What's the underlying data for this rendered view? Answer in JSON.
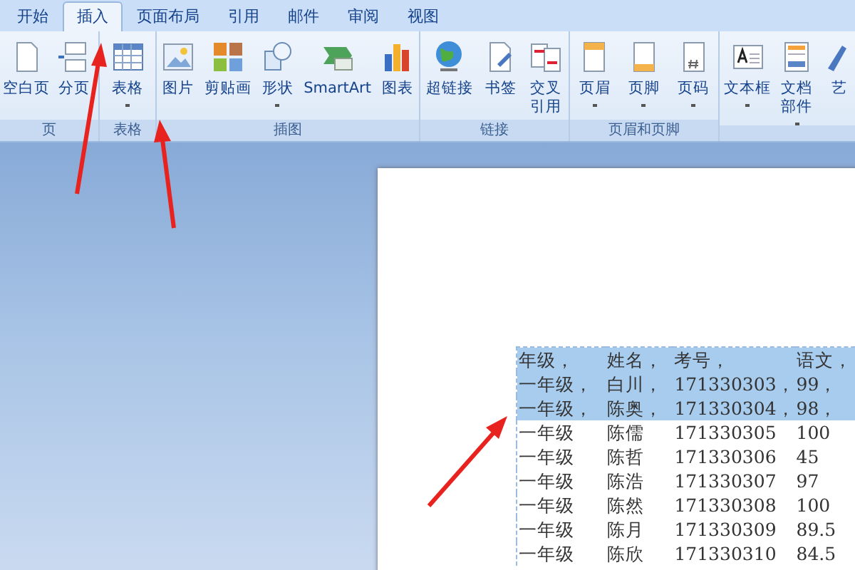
{
  "tabs": [
    {
      "label": "开始",
      "selected": false
    },
    {
      "label": "插入",
      "selected": true
    },
    {
      "label": "页面布局",
      "selected": false
    },
    {
      "label": "引用",
      "selected": false
    },
    {
      "label": "邮件",
      "selected": false
    },
    {
      "label": "审阅",
      "selected": false
    },
    {
      "label": "视图",
      "selected": false
    }
  ],
  "groups": [
    {
      "label": "页",
      "items": [
        {
          "label": "空白页",
          "dropdown": false
        },
        {
          "label": "分页",
          "dropdown": false
        }
      ]
    },
    {
      "label": "表格",
      "items": [
        {
          "label": "表格",
          "dropdown": true
        }
      ]
    },
    {
      "label": "插图",
      "items": [
        {
          "label": "图片",
          "dropdown": false
        },
        {
          "label": "剪贴画",
          "dropdown": false
        },
        {
          "label": "形状",
          "dropdown": true
        },
        {
          "label": "SmartArt",
          "dropdown": false
        },
        {
          "label": "图表",
          "dropdown": false
        }
      ]
    },
    {
      "label": "链接",
      "items": [
        {
          "label": "超链接",
          "dropdown": false
        },
        {
          "label": "书签",
          "dropdown": false
        },
        {
          "label": "交叉引用",
          "dropdown": false
        }
      ]
    },
    {
      "label": "页眉和页脚",
      "items": [
        {
          "label": "页眉",
          "dropdown": true
        },
        {
          "label": "页脚",
          "dropdown": true
        },
        {
          "label": "页码",
          "dropdown": true
        }
      ]
    },
    {
      "items": [
        {
          "label": "文本框",
          "dropdown": true
        },
        {
          "label": "文档部件",
          "dropdown": true
        },
        {
          "label": "艺",
          "dropdown": false
        }
      ]
    }
  ],
  "document": {
    "table": {
      "rows": [
        {
          "cells": [
            "年级，",
            "姓名，",
            "考号，",
            "语文，"
          ],
          "selected": true
        },
        {
          "cells": [
            "一年级，",
            "白川，",
            "171330303，",
            "99，"
          ],
          "selected": true
        },
        {
          "cells": [
            "一年级，",
            "陈奥，",
            "171330304，",
            "98，"
          ],
          "selected": true
        },
        {
          "cells": [
            "一年级",
            "陈儒",
            "171330305",
            "100"
          ],
          "selected": false
        },
        {
          "cells": [
            "一年级",
            "陈哲",
            "171330306",
            "45"
          ],
          "selected": false
        },
        {
          "cells": [
            "一年级",
            "陈浩",
            "171330307",
            "97"
          ],
          "selected": false
        },
        {
          "cells": [
            "一年级",
            "陈然",
            "171330308",
            "100"
          ],
          "selected": false
        },
        {
          "cells": [
            "一年级",
            "陈月",
            "171330309",
            "89.5"
          ],
          "selected": false
        },
        {
          "cells": [
            "一年级",
            "陈欣",
            "171330310",
            "84.5"
          ],
          "selected": false
        }
      ]
    }
  }
}
